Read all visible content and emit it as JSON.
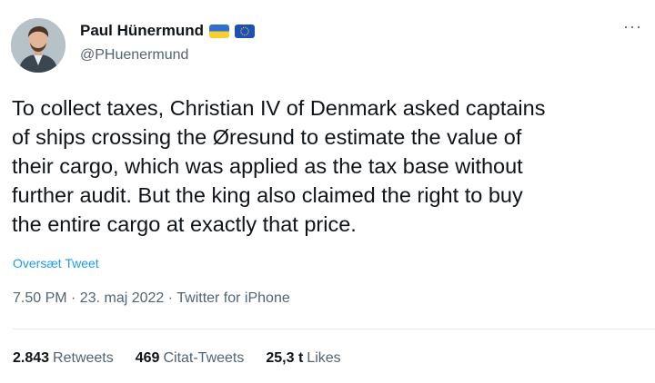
{
  "author": {
    "display_name": "Paul Hünermund",
    "handle": "@PHuenermund",
    "flags": [
      "ukraine-flag-icon",
      "eu-flag-icon"
    ]
  },
  "more_label": "···",
  "tweet": {
    "text": "To collect taxes, Christian IV of Denmark asked captains\nof ships crossing the Øresund to estimate the value of\ntheir cargo, which was applied as the tax base without\nfurther audit. But the king also claimed the right to buy\nthe entire cargo at exactly that price.",
    "translate_label": "Oversæt Tweet",
    "meta": "7.50 PM · 23. maj 2022 · Twitter for iPhone"
  },
  "stats": {
    "retweets_count": "2.843",
    "retweets_label": "Retweets",
    "quotes_count": "469",
    "quotes_label": "Citat-Tweets",
    "likes_count": "25,3 t",
    "likes_label": "Likes"
  },
  "colors": {
    "link": "#1d9bf0",
    "muted": "#536471",
    "text": "#0f1419"
  }
}
